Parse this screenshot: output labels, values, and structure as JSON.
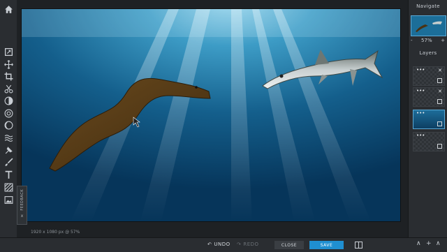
{
  "navigate": {
    "title": "Navigate",
    "zoom_minus": "-",
    "zoom_value": "57%",
    "zoom_plus": "+"
  },
  "layers": {
    "title": "Layers",
    "items": [
      {
        "menu": "•••",
        "close": "✕"
      },
      {
        "menu": "•••",
        "close": "✕"
      },
      {
        "menu": "•••",
        "close": ""
      },
      {
        "menu": "•••",
        "close": ""
      }
    ]
  },
  "canvas": {
    "dims": "1920 x 1080 px @ 57%"
  },
  "feedback": {
    "label": "FEEDBACK",
    "close": "x"
  },
  "bottom": {
    "undo": "UNDO",
    "redo": "REDO",
    "close": "CLOSE",
    "save": "SAVE"
  },
  "colors": {
    "accent": "#1f8fd1",
    "panel": "#2a2d31",
    "water_top": "#2f8db8",
    "water_bottom": "#063556"
  }
}
